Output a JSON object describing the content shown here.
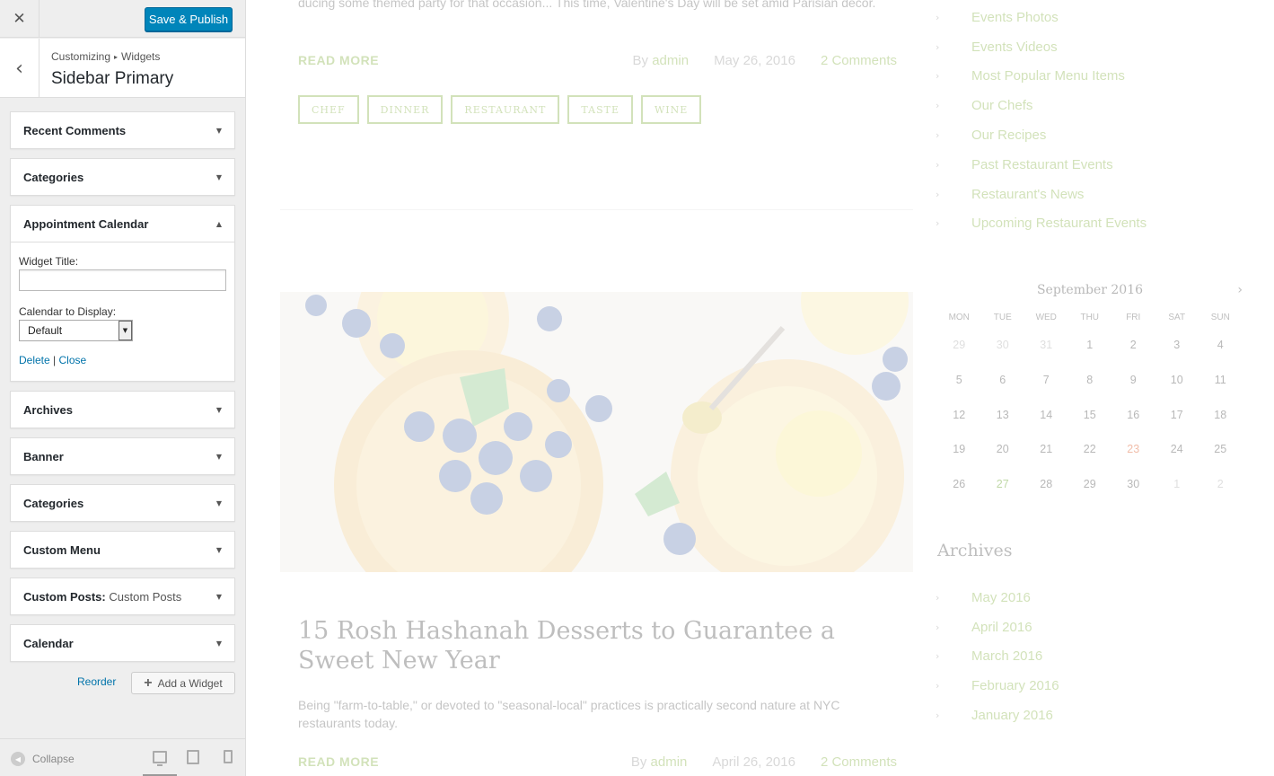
{
  "header": {
    "close_icon": "close-icon",
    "save_label": "Save & Publish"
  },
  "title_section": {
    "breadcrumb_1": "Customizing",
    "breadcrumb_sep": "▸",
    "breadcrumb_2": "Widgets",
    "title": "Sidebar Primary"
  },
  "widgets": [
    {
      "name": "Recent Comments"
    },
    {
      "name": "Categories"
    },
    {
      "name": "Appointment Calendar"
    },
    {
      "name": "Archives"
    },
    {
      "name": "Banner"
    },
    {
      "name": "Categories"
    },
    {
      "name": "Custom Menu"
    },
    {
      "name": "Custom Posts:",
      "sub": "Custom Posts"
    },
    {
      "name": "Calendar"
    }
  ],
  "appointment_form": {
    "title_label": "Widget Title:",
    "title_value": "",
    "calendar_label": "Calendar to Display:",
    "calendar_value": "Default",
    "delete_label": "Delete",
    "link_sep": "|",
    "close_label": "Close"
  },
  "actions": {
    "reorder_label": "Reorder",
    "add_widget_label": "Add a Widget"
  },
  "footer": {
    "collapse_label": "Collapse"
  },
  "preview": {
    "excerpt_top": "ducing some themed party for that occasion... This time, Valentine's Day will be set amid Parisian decor.",
    "read_more": "READ MORE",
    "post1_by": "By",
    "post1_author": "admin",
    "post1_date": "May 26, 2016",
    "post1_comments": "2 Comments",
    "tags": [
      "CHEF",
      "DINNER",
      "RESTAURANT",
      "TASTE",
      "WINE"
    ],
    "post2_title": "15 Rosh Hashanah Desserts to Guarantee a Sweet New Year",
    "post2_excerpt": "Being \"farm-to-table,\" or devoted to \"seasonal-local\" practices is practically second nature at NYC restaurants today.",
    "post2_by": "By",
    "post2_author": "admin",
    "post2_date": "April 26, 2016",
    "post2_comments": "2 Comments",
    "categories": [
      "Events Photos",
      "Events Videos",
      "Most Popular Menu Items",
      "Our Chefs",
      "Our Recipes",
      "Past Restaurant Events",
      "Restaurant's News",
      "Upcoming Restaurant Events"
    ],
    "calendar": {
      "month": "September 2016",
      "days_header": [
        "MON",
        "TUE",
        "WED",
        "THU",
        "FRI",
        "SAT",
        "SUN"
      ],
      "weeks": [
        [
          "29",
          "30",
          "31",
          "1",
          "2",
          "3",
          "4"
        ],
        [
          "5",
          "6",
          "7",
          "8",
          "9",
          "10",
          "11"
        ],
        [
          "12",
          "13",
          "14",
          "15",
          "16",
          "17",
          "18"
        ],
        [
          "19",
          "20",
          "21",
          "22",
          "23",
          "24",
          "25"
        ],
        [
          "26",
          "27",
          "28",
          "29",
          "30",
          "1",
          "2"
        ]
      ],
      "highlight_red": "23",
      "highlight_green": "27"
    },
    "archives_title": "Archives",
    "archives": [
      "May 2016",
      "April 2016",
      "March 2016",
      "February 2016",
      "January 2016"
    ]
  }
}
